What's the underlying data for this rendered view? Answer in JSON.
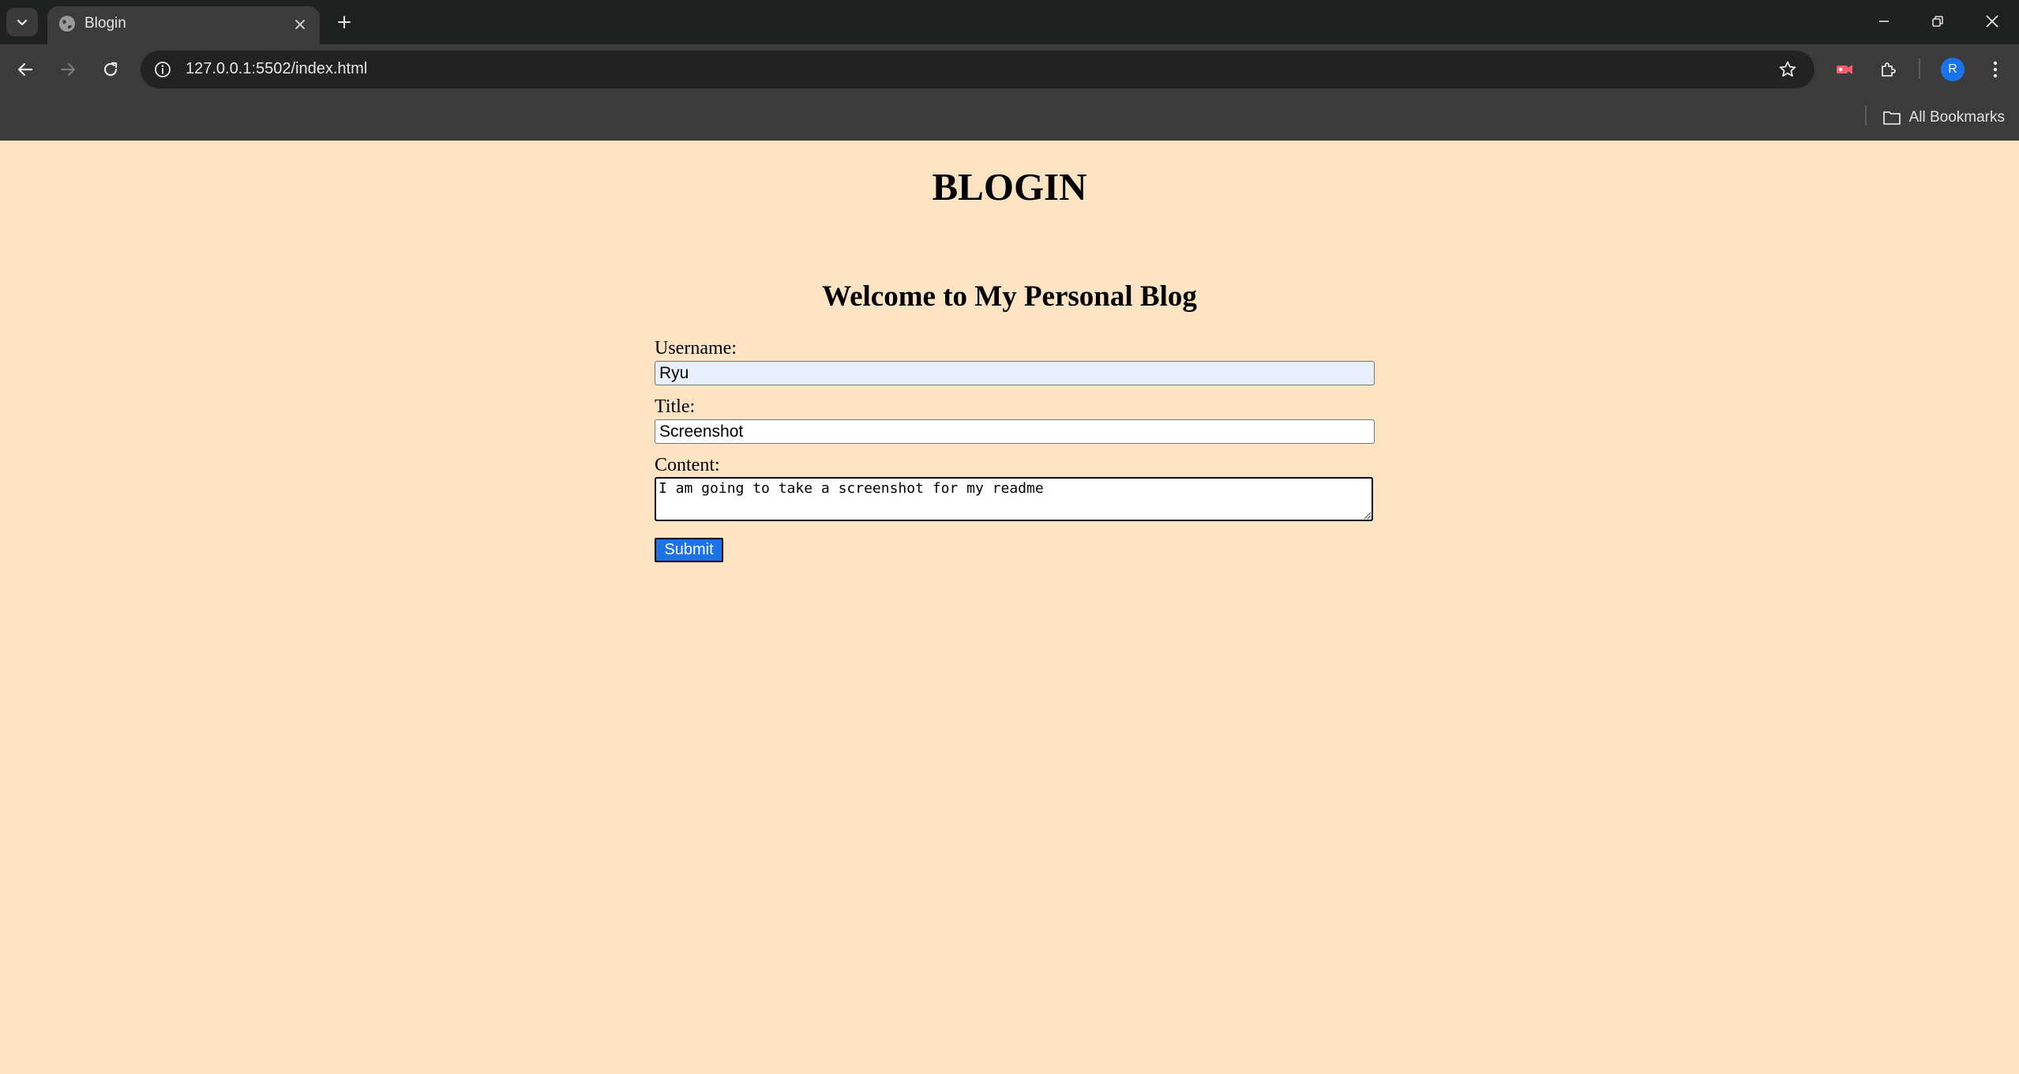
{
  "browser": {
    "tab": {
      "title": "Blogin"
    },
    "address_bar": {
      "url": "127.0.0.1:5502/index.html"
    },
    "profile_initial": "R",
    "bookmarks_bar": {
      "all_bookmarks_label": "All Bookmarks"
    },
    "icons": [
      "tab-search-icon",
      "globe-icon",
      "close-icon",
      "plus-icon",
      "minimize-icon",
      "restore-icon",
      "close-window-icon",
      "back-arrow-icon",
      "forward-arrow-icon",
      "reload-icon",
      "info-icon",
      "star-icon",
      "record-icon",
      "extensions-icon",
      "kebab-menu-icon",
      "folder-icon"
    ]
  },
  "page": {
    "site_title": "BLOGIN",
    "heading": "Welcome to My Personal Blog",
    "form": {
      "username_label": "Username:",
      "username_value": "Ryu",
      "title_label": "Title:",
      "title_value": "Screenshot",
      "content_label": "Content:",
      "content_value": "I am going to take a screenshot for my readme",
      "submit_label": "Submit"
    }
  },
  "colors": {
    "page_background": "#ffe4c4",
    "submit_button": "#1a73e8",
    "autofill_background": "#e8f0fe",
    "chrome_dark": "#1f2020",
    "chrome_toolbar": "#3b3b3b"
  }
}
